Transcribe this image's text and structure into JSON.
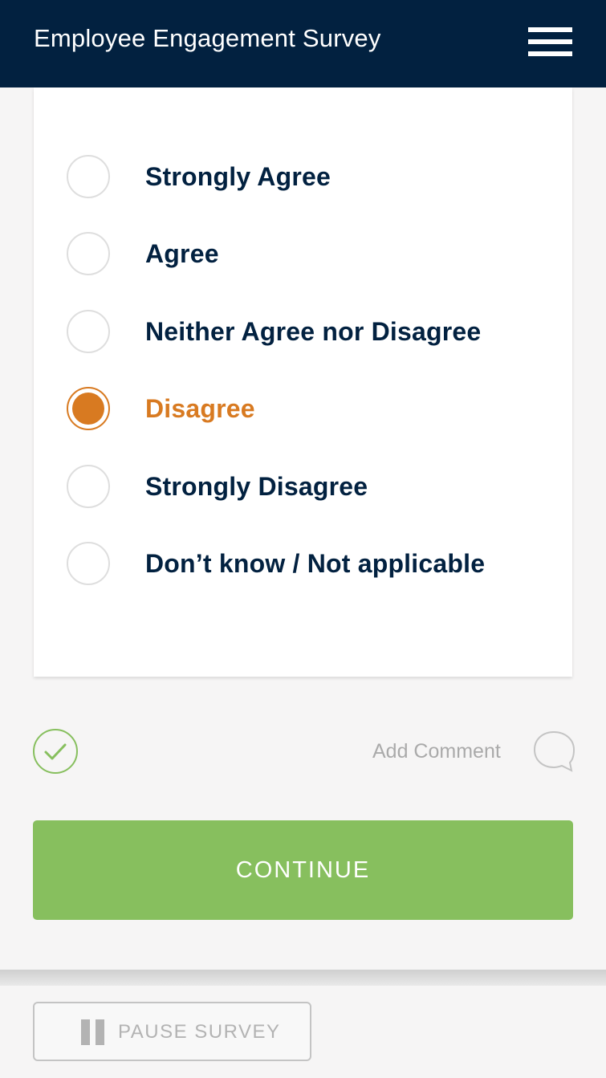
{
  "header": {
    "title": "Employee Engagement Survey",
    "menu_icon": "hamburger-menu-icon"
  },
  "question": {
    "options": [
      {
        "label": "Strongly Agree",
        "selected": false
      },
      {
        "label": "Agree",
        "selected": false
      },
      {
        "label": "Neither Agree nor Disagree",
        "selected": false
      },
      {
        "label": "Disagree",
        "selected": true
      },
      {
        "label": "Strongly Disagree",
        "selected": false
      },
      {
        "label": "Don’t know / Not applicable",
        "selected": false
      }
    ]
  },
  "actions": {
    "add_comment_label": "Add Comment",
    "continue_label": "CONTINUE"
  },
  "footer": {
    "pause_label": "PAUSE SURVEY"
  },
  "colors": {
    "header_bg": "#022140",
    "selected": "#d87a21",
    "continue_bg": "#87bf5e",
    "text_primary": "#022140"
  }
}
